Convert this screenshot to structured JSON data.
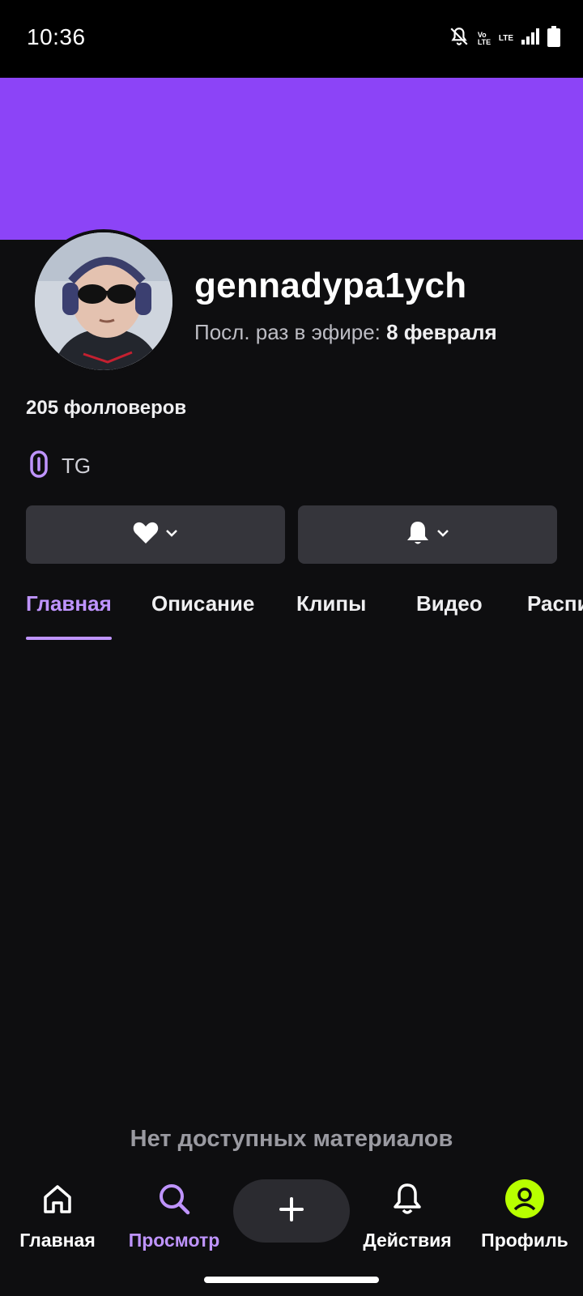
{
  "status_bar": {
    "time": "10:36",
    "network_label": "Vo LTE",
    "lte_label": "LTE"
  },
  "profile": {
    "username": "gennadypa1ych",
    "last_live_prefix": "Посл. раз в эфире: ",
    "last_live_date": "8 февраля",
    "followers": "205 фолловеров",
    "link_label": "TG"
  },
  "buttons": {
    "follow_icon": "heart-icon",
    "notify_icon": "bell-icon"
  },
  "tabs": [
    {
      "label": "Главная",
      "active": true
    },
    {
      "label": "Описание"
    },
    {
      "label": "Клипы"
    },
    {
      "label": "Видео"
    },
    {
      "label": "Расписание"
    }
  ],
  "empty_state": "Нет доступных материалов",
  "bottom_nav": [
    {
      "label": "Главная",
      "icon": "home-icon"
    },
    {
      "label": "Просмотр",
      "icon": "search-icon",
      "active": true
    },
    {
      "label": "",
      "icon": "plus-icon"
    },
    {
      "label": "Действия",
      "icon": "bell-icon"
    },
    {
      "label": "Профиль",
      "icon": "user-avatar-icon"
    }
  ],
  "colors": {
    "accent": "#bf94ff",
    "banner": "#8c44f7",
    "background": "#0e0e10",
    "profile_badge": "#b8ff00"
  }
}
